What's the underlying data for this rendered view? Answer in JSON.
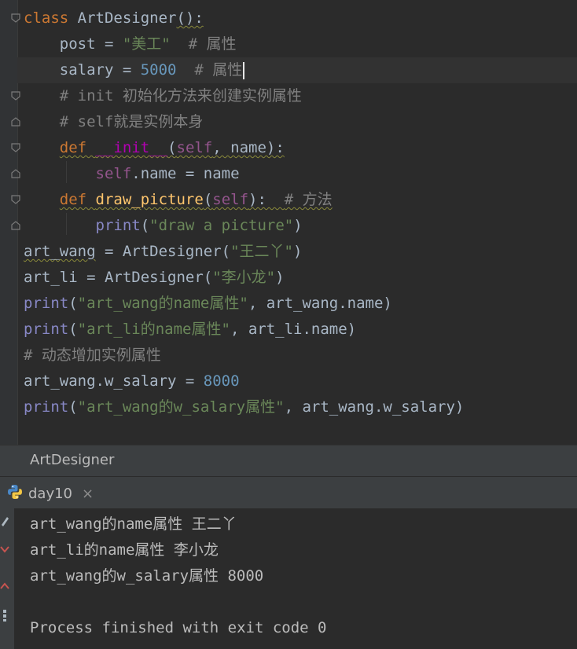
{
  "editor": {
    "lines": [
      {
        "parts": [
          {
            "t": "class ",
            "c": "kw"
          },
          {
            "t": "ArtDesigner",
            "c": ""
          },
          {
            "t": "():",
            "c": "squig2"
          }
        ]
      },
      {
        "parts": [
          {
            "t": "    post = ",
            "c": ""
          },
          {
            "t": "\"美工\"",
            "c": "str"
          },
          {
            "t": "  # 属性",
            "c": "cmt"
          }
        ]
      },
      {
        "parts": [
          {
            "t": "    salary = ",
            "c": ""
          },
          {
            "t": "5000",
            "c": "num"
          },
          {
            "t": "  # 属性",
            "c": "cmt"
          }
        ],
        "caret": true
      },
      {
        "parts": [
          {
            "t": "    # init 初始化方法来创建实例属性",
            "c": "cmt"
          }
        ]
      },
      {
        "parts": [
          {
            "t": "    # self就是实例本身",
            "c": "cmt"
          }
        ]
      },
      {
        "parts": [
          {
            "t": "    ",
            "c": ""
          },
          {
            "t": "def ",
            "c": "kw"
          },
          {
            "t": "__init__",
            "c": "dunder"
          },
          {
            "t": "(",
            "c": ""
          },
          {
            "t": "self",
            "c": "self"
          },
          {
            "t": ", name):",
            "c": ""
          }
        ],
        "squig": true
      },
      {
        "parts": [
          {
            "t": "        ",
            "c": ""
          },
          {
            "t": "self",
            "c": "self"
          },
          {
            "t": ".name = name",
            "c": ""
          }
        ]
      },
      {
        "parts": [
          {
            "t": "    ",
            "c": ""
          },
          {
            "t": "def ",
            "c": "kw"
          },
          {
            "t": "draw_picture",
            "c": "fn"
          },
          {
            "t": "(",
            "c": ""
          },
          {
            "t": "self",
            "c": "self"
          },
          {
            "t": "):  ",
            "c": ""
          },
          {
            "t": "# 方法",
            "c": "cmt"
          }
        ],
        "squig": true
      },
      {
        "parts": [
          {
            "t": "        ",
            "c": ""
          },
          {
            "t": "print",
            "c": "builtin"
          },
          {
            "t": "(",
            "c": ""
          },
          {
            "t": "\"draw a picture\"",
            "c": "str"
          },
          {
            "t": ")",
            "c": ""
          }
        ]
      },
      {
        "parts": [
          {
            "t": "art_wang",
            "c": "squig2"
          },
          {
            "t": " = ArtDesigner(",
            "c": ""
          },
          {
            "t": "\"王二丫\"",
            "c": "str"
          },
          {
            "t": ")",
            "c": ""
          }
        ]
      },
      {
        "parts": [
          {
            "t": "art_li = ArtDesigner(",
            "c": ""
          },
          {
            "t": "\"李小龙\"",
            "c": "str"
          },
          {
            "t": ")",
            "c": ""
          }
        ]
      },
      {
        "parts": [
          {
            "t": "print",
            "c": "builtin"
          },
          {
            "t": "(",
            "c": ""
          },
          {
            "t": "\"art_wang的name属性\"",
            "c": "str"
          },
          {
            "t": ", art_wang.name)",
            "c": ""
          }
        ]
      },
      {
        "parts": [
          {
            "t": "print",
            "c": "builtin"
          },
          {
            "t": "(",
            "c": ""
          },
          {
            "t": "\"art_li的name属性\"",
            "c": "str"
          },
          {
            "t": ", art_li.name)",
            "c": ""
          }
        ]
      },
      {
        "parts": [
          {
            "t": "# 动态增加实例属性",
            "c": "cmt"
          }
        ]
      },
      {
        "parts": [
          {
            "t": "art_wang.w_salary = ",
            "c": ""
          },
          {
            "t": "8000",
            "c": "num"
          }
        ]
      },
      {
        "parts": [
          {
            "t": "print",
            "c": "builtin"
          },
          {
            "t": "(",
            "c": ""
          },
          {
            "t": "\"art_wang的w_salary属性\"",
            "c": "str"
          },
          {
            "t": ", art_wang.w_salary)",
            "c": ""
          }
        ]
      }
    ]
  },
  "breadcrumb": {
    "label": "ArtDesigner"
  },
  "run_tab": {
    "label": "day10",
    "close": "×"
  },
  "console": {
    "lines": [
      "art_wang的name属性 王二丫",
      "art_li的name属性 李小龙",
      "art_wang的w_salary属性 8000",
      "",
      "Process finished with exit code 0"
    ]
  }
}
